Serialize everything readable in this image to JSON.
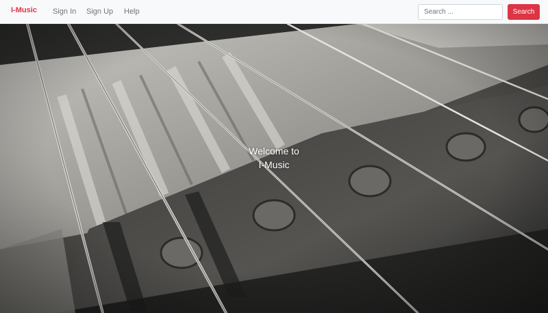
{
  "navbar": {
    "brand": "I-Music",
    "links": [
      {
        "label": "Sign In"
      },
      {
        "label": "Sign Up"
      },
      {
        "label": "Help"
      }
    ],
    "search": {
      "placeholder": "Search ...",
      "value": "",
      "button_label": "Search"
    }
  },
  "hero": {
    "title_line1": "Welcome to",
    "title_line2": "I-Music",
    "image_subject": "guitar strings close-up (black and white photo)"
  },
  "colors": {
    "brand": "#dc3545",
    "navbar_bg": "#f8f9fa",
    "nav_link": "#6c757d",
    "hero_text": "#ffffff"
  }
}
